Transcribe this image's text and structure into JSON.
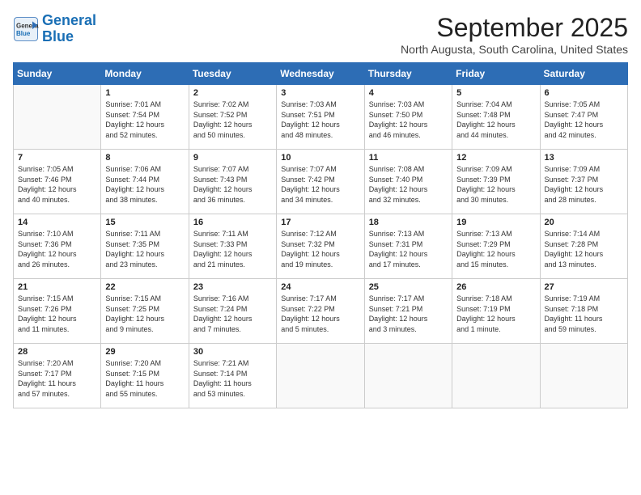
{
  "logo": {
    "line1": "General",
    "line2": "Blue"
  },
  "title": "September 2025",
  "location": "North Augusta, South Carolina, United States",
  "weekdays": [
    "Sunday",
    "Monday",
    "Tuesday",
    "Wednesday",
    "Thursday",
    "Friday",
    "Saturday"
  ],
  "weeks": [
    [
      {
        "day": "",
        "info": ""
      },
      {
        "day": "1",
        "info": "Sunrise: 7:01 AM\nSunset: 7:54 PM\nDaylight: 12 hours\nand 52 minutes."
      },
      {
        "day": "2",
        "info": "Sunrise: 7:02 AM\nSunset: 7:52 PM\nDaylight: 12 hours\nand 50 minutes."
      },
      {
        "day": "3",
        "info": "Sunrise: 7:03 AM\nSunset: 7:51 PM\nDaylight: 12 hours\nand 48 minutes."
      },
      {
        "day": "4",
        "info": "Sunrise: 7:03 AM\nSunset: 7:50 PM\nDaylight: 12 hours\nand 46 minutes."
      },
      {
        "day": "5",
        "info": "Sunrise: 7:04 AM\nSunset: 7:48 PM\nDaylight: 12 hours\nand 44 minutes."
      },
      {
        "day": "6",
        "info": "Sunrise: 7:05 AM\nSunset: 7:47 PM\nDaylight: 12 hours\nand 42 minutes."
      }
    ],
    [
      {
        "day": "7",
        "info": "Sunrise: 7:05 AM\nSunset: 7:46 PM\nDaylight: 12 hours\nand 40 minutes."
      },
      {
        "day": "8",
        "info": "Sunrise: 7:06 AM\nSunset: 7:44 PM\nDaylight: 12 hours\nand 38 minutes."
      },
      {
        "day": "9",
        "info": "Sunrise: 7:07 AM\nSunset: 7:43 PM\nDaylight: 12 hours\nand 36 minutes."
      },
      {
        "day": "10",
        "info": "Sunrise: 7:07 AM\nSunset: 7:42 PM\nDaylight: 12 hours\nand 34 minutes."
      },
      {
        "day": "11",
        "info": "Sunrise: 7:08 AM\nSunset: 7:40 PM\nDaylight: 12 hours\nand 32 minutes."
      },
      {
        "day": "12",
        "info": "Sunrise: 7:09 AM\nSunset: 7:39 PM\nDaylight: 12 hours\nand 30 minutes."
      },
      {
        "day": "13",
        "info": "Sunrise: 7:09 AM\nSunset: 7:37 PM\nDaylight: 12 hours\nand 28 minutes."
      }
    ],
    [
      {
        "day": "14",
        "info": "Sunrise: 7:10 AM\nSunset: 7:36 PM\nDaylight: 12 hours\nand 26 minutes."
      },
      {
        "day": "15",
        "info": "Sunrise: 7:11 AM\nSunset: 7:35 PM\nDaylight: 12 hours\nand 23 minutes."
      },
      {
        "day": "16",
        "info": "Sunrise: 7:11 AM\nSunset: 7:33 PM\nDaylight: 12 hours\nand 21 minutes."
      },
      {
        "day": "17",
        "info": "Sunrise: 7:12 AM\nSunset: 7:32 PM\nDaylight: 12 hours\nand 19 minutes."
      },
      {
        "day": "18",
        "info": "Sunrise: 7:13 AM\nSunset: 7:31 PM\nDaylight: 12 hours\nand 17 minutes."
      },
      {
        "day": "19",
        "info": "Sunrise: 7:13 AM\nSunset: 7:29 PM\nDaylight: 12 hours\nand 15 minutes."
      },
      {
        "day": "20",
        "info": "Sunrise: 7:14 AM\nSunset: 7:28 PM\nDaylight: 12 hours\nand 13 minutes."
      }
    ],
    [
      {
        "day": "21",
        "info": "Sunrise: 7:15 AM\nSunset: 7:26 PM\nDaylight: 12 hours\nand 11 minutes."
      },
      {
        "day": "22",
        "info": "Sunrise: 7:15 AM\nSunset: 7:25 PM\nDaylight: 12 hours\nand 9 minutes."
      },
      {
        "day": "23",
        "info": "Sunrise: 7:16 AM\nSunset: 7:24 PM\nDaylight: 12 hours\nand 7 minutes."
      },
      {
        "day": "24",
        "info": "Sunrise: 7:17 AM\nSunset: 7:22 PM\nDaylight: 12 hours\nand 5 minutes."
      },
      {
        "day": "25",
        "info": "Sunrise: 7:17 AM\nSunset: 7:21 PM\nDaylight: 12 hours\nand 3 minutes."
      },
      {
        "day": "26",
        "info": "Sunrise: 7:18 AM\nSunset: 7:19 PM\nDaylight: 12 hours\nand 1 minute."
      },
      {
        "day": "27",
        "info": "Sunrise: 7:19 AM\nSunset: 7:18 PM\nDaylight: 11 hours\nand 59 minutes."
      }
    ],
    [
      {
        "day": "28",
        "info": "Sunrise: 7:20 AM\nSunset: 7:17 PM\nDaylight: 11 hours\nand 57 minutes."
      },
      {
        "day": "29",
        "info": "Sunrise: 7:20 AM\nSunset: 7:15 PM\nDaylight: 11 hours\nand 55 minutes."
      },
      {
        "day": "30",
        "info": "Sunrise: 7:21 AM\nSunset: 7:14 PM\nDaylight: 11 hours\nand 53 minutes."
      },
      {
        "day": "",
        "info": ""
      },
      {
        "day": "",
        "info": ""
      },
      {
        "day": "",
        "info": ""
      },
      {
        "day": "",
        "info": ""
      }
    ]
  ]
}
